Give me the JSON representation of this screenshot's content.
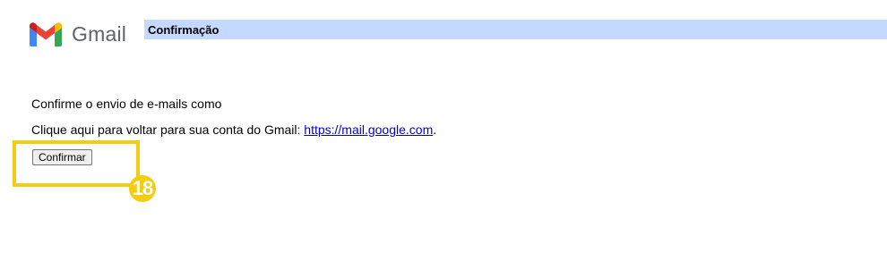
{
  "header": {
    "logo_text": "Gmail",
    "title": "Confirmação"
  },
  "content": {
    "line1": "Confirme o envio de e-mails como",
    "line2_prefix": "Clique aqui para voltar para sua conta do Gmail: ",
    "link_text": "https://mail.google.com",
    "line2_suffix": "."
  },
  "form": {
    "confirm_label": "Confirmar"
  },
  "annotation": {
    "step_number": "18",
    "color": "#f2cd12"
  },
  "colors": {
    "title_bar": "#c3d9ff",
    "link": "#0000cc",
    "gmail_red": "#ea4335",
    "gmail_blue": "#4285f4",
    "gmail_green": "#34a853",
    "gmail_yellow": "#fbbc04",
    "gmail_dark_red": "#c5221f"
  },
  "icons": {
    "logo": "gmail-m-icon"
  }
}
